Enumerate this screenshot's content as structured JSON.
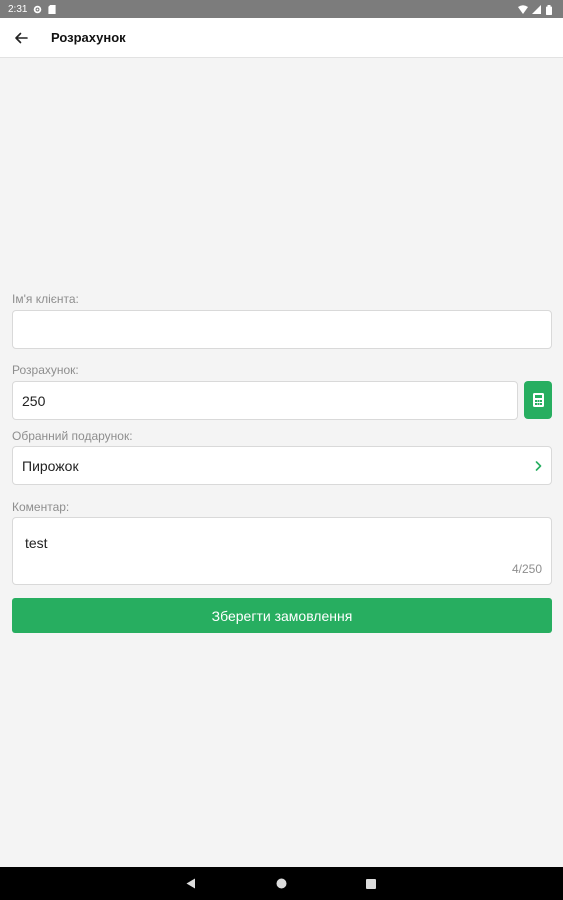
{
  "status_bar": {
    "time": "2:31",
    "left_icons": [
      "gear-icon",
      "sd-card-icon"
    ],
    "right_icons": [
      "wifi-icon",
      "signal-icon",
      "battery-icon"
    ]
  },
  "app_bar": {
    "back_icon": "arrow-left-icon",
    "title": "Розрахунок"
  },
  "form": {
    "client_name": {
      "label": "Ім'я клієнта:",
      "value": ""
    },
    "amount": {
      "label": "Розрахунок:",
      "value": "250",
      "button_icon": "calculator-icon"
    },
    "gift": {
      "label": "Обранний подарунок:",
      "value": "Пирожок",
      "icon": "chevron-right-icon"
    },
    "comment": {
      "label": "Коментар:",
      "value": "test",
      "counter": "4/250"
    },
    "save_label": "Зберегти замовлення"
  },
  "nav_bar": {
    "icons": [
      "back-triangle-icon",
      "home-circle-icon",
      "recents-square-icon"
    ]
  },
  "colors": {
    "accent": "#27ae60",
    "background": "#f4f4f4",
    "status_bar": "#7c7c7c",
    "label": "#8e8e8e"
  }
}
